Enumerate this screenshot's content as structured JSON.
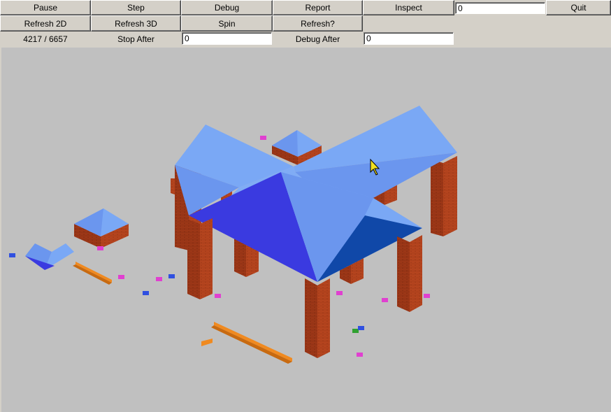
{
  "toolbar": {
    "pause_label": "Pause",
    "step_label": "Step",
    "debug_label": "Debug",
    "report_label": "Report",
    "inspect_label": "Inspect",
    "inspect_value": "0",
    "quit_label": "Quit",
    "refresh2d_label": "Refresh 2D",
    "refresh3d_label": "Refresh 3D",
    "spin_label": "Spin",
    "refresh_q_label": "Refresh?",
    "progress_text": "4217 / 6657",
    "stop_after_label": "Stop After",
    "stop_after_value": "0",
    "debug_after_label": "Debug After",
    "debug_after_value": "0"
  },
  "scene": {
    "background": "#c0c0c0",
    "roof_light": "#7aa8f5",
    "roof_mid": "#6b96ee",
    "roof_dark": "#3a3ae0",
    "roof_deep": "#1048a8",
    "brick": "#c04a22",
    "plank": "#f08a20",
    "marker_magenta": "#e040d0",
    "marker_blue": "#3050e0",
    "marker_green": "#30a030",
    "cursor_color": "#f0e020"
  }
}
